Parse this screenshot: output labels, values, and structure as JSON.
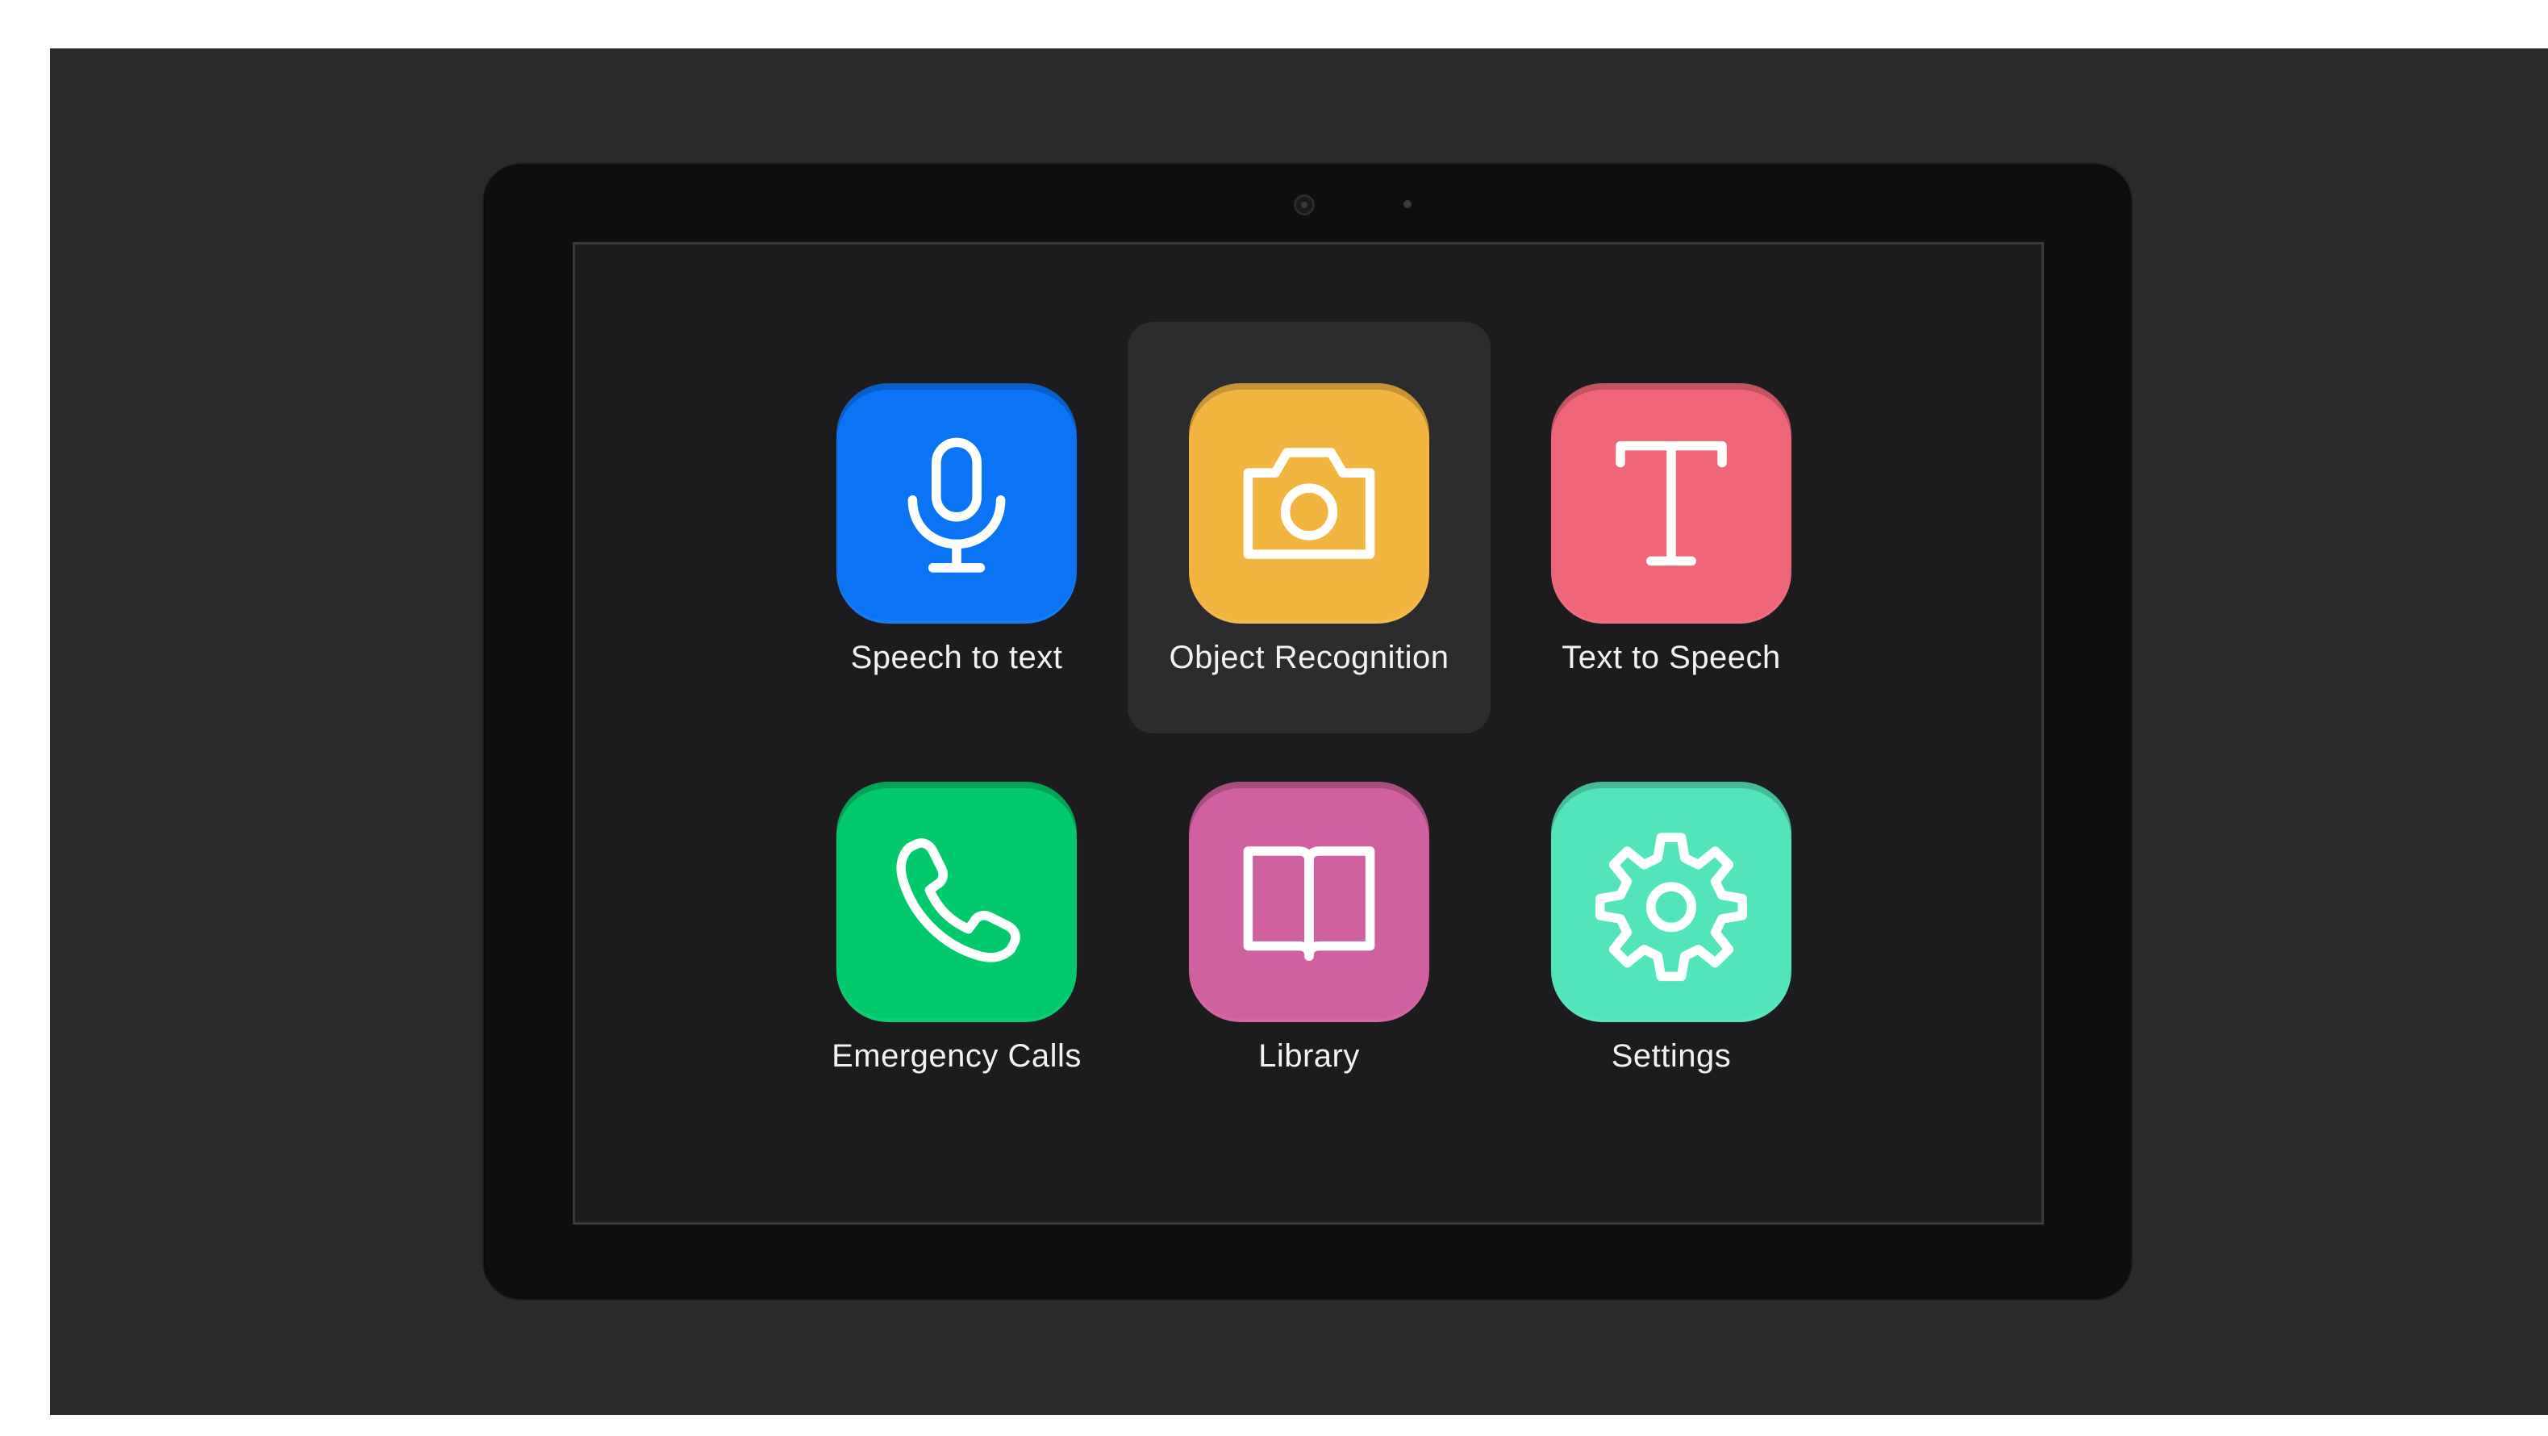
{
  "apps": [
    {
      "label": "Speech to text",
      "icon": "microphone-icon",
      "color": "#0a74f5",
      "selected": false
    },
    {
      "label": "Object Recognition",
      "icon": "camera-icon",
      "color": "#f2b540",
      "selected": true
    },
    {
      "label": "Text to Speech",
      "icon": "text-icon",
      "color": "#ee6677",
      "selected": false
    },
    {
      "label": "Emergency Calls",
      "icon": "phone-icon",
      "color": "#02c96b",
      "selected": false
    },
    {
      "label": "Library",
      "icon": "book-icon",
      "color": "#d0609f",
      "selected": false
    },
    {
      "label": "Settings",
      "icon": "gear-icon",
      "color": "#52e5bb",
      "selected": false
    }
  ],
  "colors": {
    "screen_background": "#1c1c1e",
    "selected_tile": "#2c2c2e",
    "label_text": "#f2f2f2"
  }
}
